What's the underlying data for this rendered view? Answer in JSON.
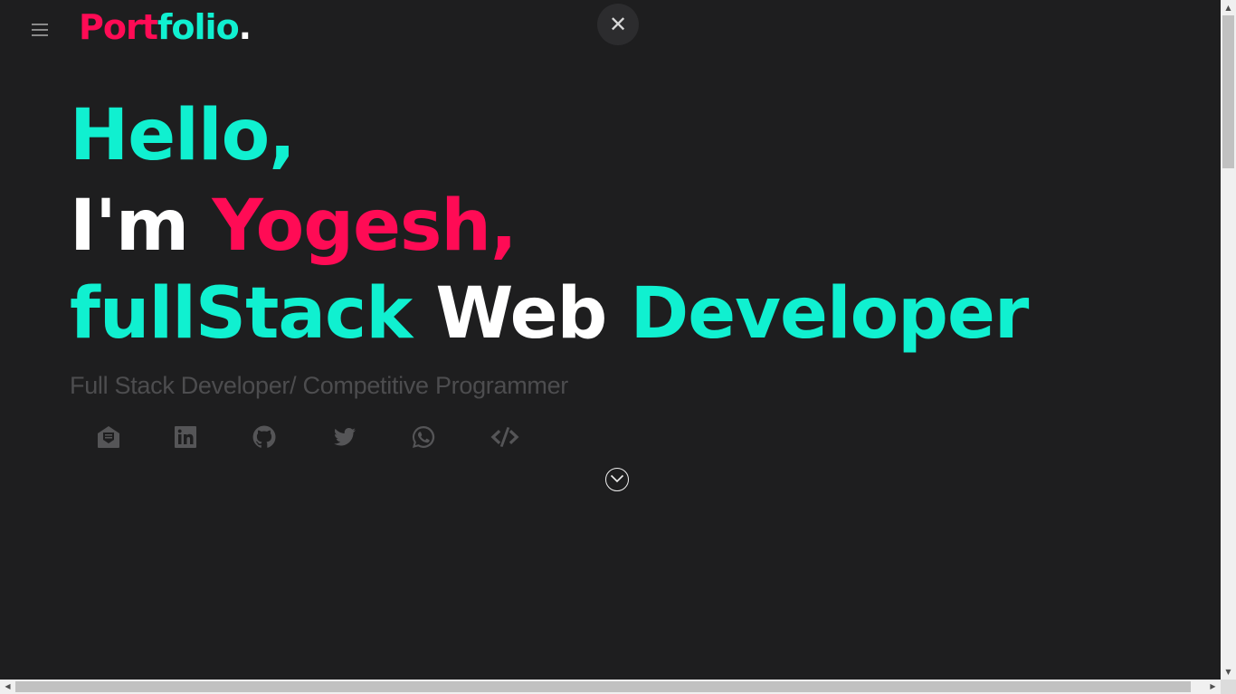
{
  "header": {
    "logo": {
      "part1": "Port",
      "part2": "folio",
      "part3": "."
    },
    "menu_icon": "hamburger-icon",
    "close_icon": "close-icon",
    "close_label": "✕"
  },
  "hero": {
    "line1": "Hello,",
    "line2": {
      "prefix": "I'm ",
      "name": "Yogesh,"
    },
    "line3": {
      "w1": "fullStack",
      "w2": "Web",
      "w3": "Developer"
    },
    "subtitle": "Full Stack Developer/ Competitive Programmer"
  },
  "socials": [
    {
      "icon": "mail-icon"
    },
    {
      "icon": "linkedin-icon"
    },
    {
      "icon": "github-icon"
    },
    {
      "icon": "twitter-icon"
    },
    {
      "icon": "whatsapp-icon"
    },
    {
      "icon": "code-icon"
    }
  ],
  "scroll_down": {
    "icon": "chevron-down-icon"
  },
  "colors": {
    "background": "#1e1e1f",
    "accent_teal": "#10f0d0",
    "accent_pink": "#ff0b55",
    "text_white": "#ffffff",
    "muted": "#4d4d4f"
  }
}
